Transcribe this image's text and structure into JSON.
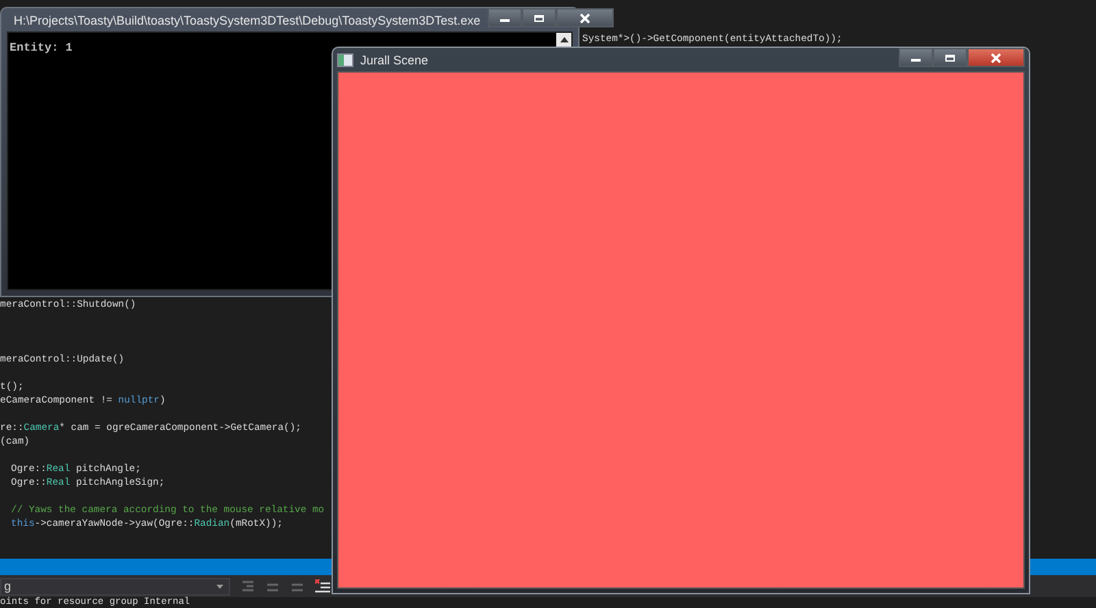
{
  "editor": {
    "top_line": "System*>()->GetComponent(entityAttachedTo));",
    "code_lines": [
      {
        "tokens": [
          {
            "text": "meraControl::Shutdown()",
            "kind": "plain"
          }
        ]
      },
      {
        "tokens": [
          {
            "text": "meraControl::Update()",
            "kind": "plain"
          }
        ]
      },
      {
        "tokens": [
          {
            "text": "t();",
            "kind": "plain"
          }
        ]
      },
      {
        "tokens": [
          {
            "text": "eCameraComponent != ",
            "kind": "plain"
          },
          {
            "text": "nullptr",
            "kind": "keyword"
          },
          {
            "text": ")",
            "kind": "plain"
          }
        ]
      },
      {
        "tokens": [
          {
            "text": "re::",
            "kind": "plain"
          },
          {
            "text": "Camera",
            "kind": "type"
          },
          {
            "text": "* cam = ogreCameraComponent->GetCamera();",
            "kind": "plain"
          }
        ]
      },
      {
        "tokens": [
          {
            "text": "(cam)",
            "kind": "plain"
          }
        ]
      },
      {
        "tokens": [
          {
            "text": "Ogre::",
            "kind": "plain"
          },
          {
            "text": "Real",
            "kind": "type"
          },
          {
            "text": " pitchAngle;",
            "kind": "plain"
          }
        ]
      },
      {
        "tokens": [
          {
            "text": "Ogre::",
            "kind": "plain"
          },
          {
            "text": "Real",
            "kind": "type"
          },
          {
            "text": " pitchAngleSign;",
            "kind": "plain"
          }
        ]
      },
      {
        "tokens": [
          {
            "text": "// Yaws the camera according to the mouse relative mo",
            "kind": "comment"
          }
        ]
      },
      {
        "tokens": [
          {
            "text": "this",
            "kind": "keyword"
          },
          {
            "text": "->cameraYawNode->yaw(Ogre::",
            "kind": "plain"
          },
          {
            "text": "Radian",
            "kind": "type"
          },
          {
            "text": "(mRotX));",
            "kind": "plain"
          }
        ]
      }
    ]
  },
  "toolbar": {
    "dropdown_value": "g"
  },
  "output_line": "oints for resource group Internal",
  "console_window": {
    "title": "H:\\Projects\\Toasty\\Build\\toasty\\ToastySystem3DTest\\Debug\\ToastySystem3DTest.exe",
    "text": "Entity: 1"
  },
  "scene_window": {
    "title": "Jurall Scene",
    "color": "#ff6060"
  }
}
